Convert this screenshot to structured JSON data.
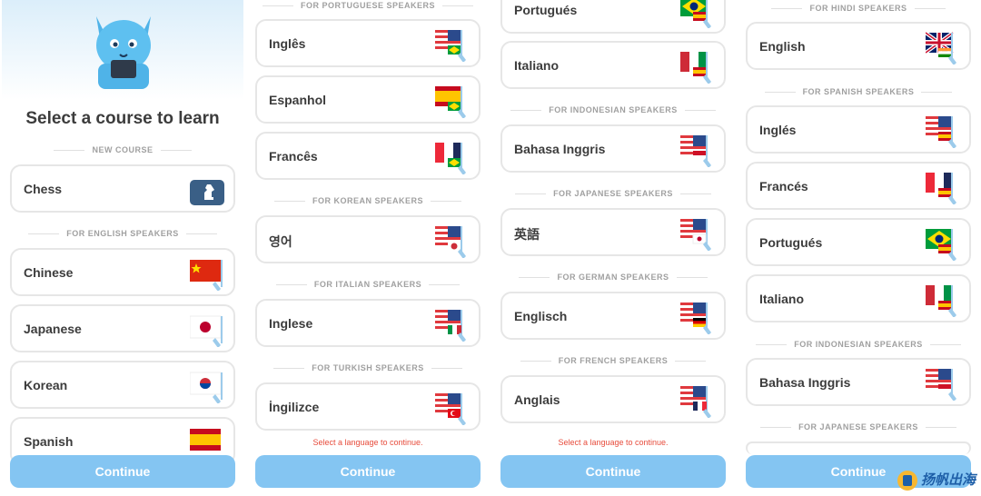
{
  "panel1": {
    "title": "Select a course to learn",
    "hdr_new": "NEW COURSE",
    "hdr_en": "FOR ENGLISH SPEAKERS",
    "rows": [
      "Chess",
      "Chinese",
      "Japanese",
      "Korean",
      "Spanish"
    ],
    "continue": "Continue"
  },
  "panel2": {
    "hdr_pt": "FOR PORTUGUESE SPEAKERS",
    "hdr_ko": "FOR KOREAN SPEAKERS",
    "hdr_it": "FOR ITALIAN SPEAKERS",
    "hdr_tr": "FOR TURKISH SPEAKERS",
    "rows": [
      "Inglês",
      "Espanhol",
      "Francês",
      "영어",
      "Inglese",
      "İngilizce"
    ],
    "warning": "Select a language to continue.",
    "continue": "Continue"
  },
  "panel3": {
    "hdr_id": "FOR INDONESIAN SPEAKERS",
    "hdr_ja": "FOR JAPANESE SPEAKERS",
    "hdr_de": "FOR GERMAN SPEAKERS",
    "hdr_fr": "FOR FRENCH SPEAKERS",
    "rows": [
      "Portugués",
      "Italiano",
      "Bahasa Inggris",
      "英語",
      "Englisch",
      "Anglais"
    ],
    "warning": "Select a language to continue.",
    "continue": "Continue"
  },
  "panel4": {
    "hdr_hi": "FOR HINDI SPEAKERS",
    "hdr_es": "FOR SPANISH SPEAKERS",
    "hdr_id": "FOR INDONESIAN SPEAKERS",
    "hdr_ja": "FOR JAPANESE SPEAKERS",
    "rows": [
      "English",
      "Inglés",
      "Francés",
      "Portugués",
      "Italiano",
      "Bahasa Inggris"
    ],
    "continue": "Continue"
  },
  "watermark": "扬帆出海",
  "colors": {
    "button": "#84c5f2",
    "warning": "#e74c3c",
    "text": "#3c3c3c",
    "header": "#a0a0a0"
  }
}
